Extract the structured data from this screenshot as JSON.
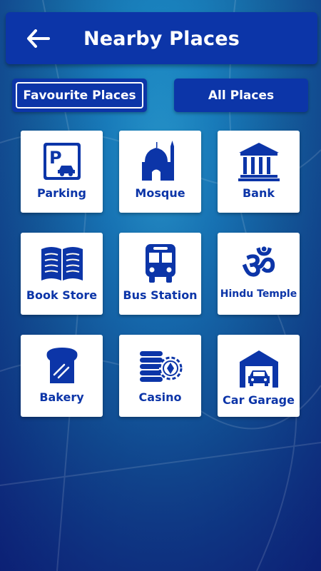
{
  "header": {
    "title": "Nearby Places",
    "back_icon": "arrow-left-icon"
  },
  "tabs": [
    {
      "label": "Favourite Places",
      "active": true
    },
    {
      "label": "All Places",
      "active": false
    }
  ],
  "places": [
    {
      "label": "Parking",
      "icon": "parking-icon"
    },
    {
      "label": "Mosque",
      "icon": "mosque-icon"
    },
    {
      "label": "Bank",
      "icon": "bank-icon"
    },
    {
      "label": "Book Store",
      "icon": "book-icon"
    },
    {
      "label": "Bus Station",
      "icon": "bus-icon"
    },
    {
      "label": "Hindu Temple",
      "icon": "om-icon"
    },
    {
      "label": "Bakery",
      "icon": "bread-icon"
    },
    {
      "label": "Casino",
      "icon": "casino-chips-icon"
    },
    {
      "label": "Car Garage",
      "icon": "garage-icon"
    }
  ],
  "colors": {
    "primary": "#0c35a8",
    "tile": "#ffffff",
    "text_on_primary": "#ffffff"
  }
}
